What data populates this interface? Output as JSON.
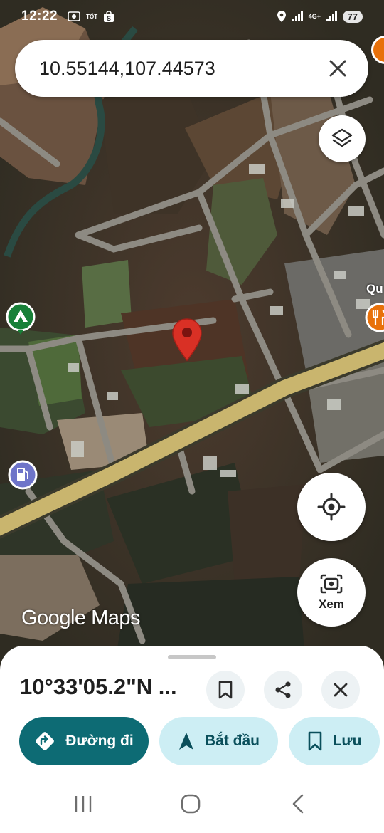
{
  "status_bar": {
    "time": "12:22",
    "carrier_badge": "TỐT",
    "network_label": "4G+",
    "battery": "77"
  },
  "search": {
    "query": "10.55144,107.44573"
  },
  "map": {
    "poi_label": "Qu",
    "watermark": "Google Maps"
  },
  "lens": {
    "label": "Xem"
  },
  "place": {
    "title": "10°33'05.2\"N ..."
  },
  "actions": {
    "directions": "Đường đi",
    "start": "Bắt đầu",
    "save": "Lưu"
  },
  "colors": {
    "primary": "#0d6b74",
    "primary_light": "#cdeef4",
    "pin": "#d93025",
    "highway": "#c9b56e"
  },
  "icons": {
    "clear": "close-icon",
    "layers": "layers-icon",
    "locate": "my-location-icon",
    "lens": "camera-lens-icon",
    "bookmark": "bookmark-icon",
    "share": "share-icon",
    "close": "close-icon",
    "directions": "directions-icon",
    "navigate": "navigation-arrow-icon"
  }
}
